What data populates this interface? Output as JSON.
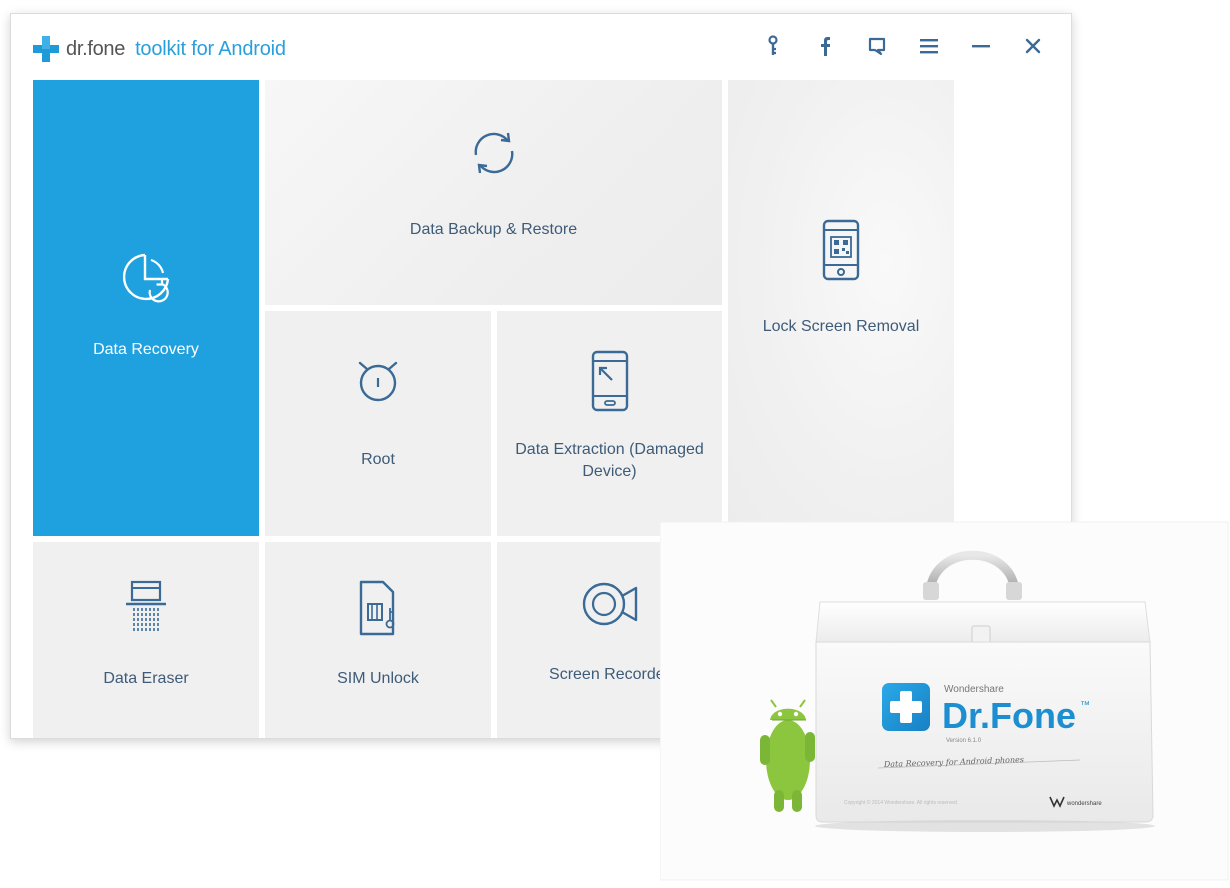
{
  "app": {
    "brand": "dr.fone",
    "product": "toolkit for Android"
  },
  "titlebar": {
    "icons": [
      "key-icon",
      "facebook-icon",
      "feedback-icon",
      "menu-icon",
      "minimize-icon",
      "close-icon"
    ]
  },
  "tiles": {
    "data_recovery": {
      "label": "Data Recovery",
      "icon": "pie-chart-refresh-icon"
    },
    "backup_restore": {
      "label": "Data Backup & Restore",
      "icon": "sync-icon"
    },
    "lock_screen": {
      "label": "Lock Screen Removal",
      "icon": "phone-lock-icon"
    },
    "root": {
      "label": "Root",
      "icon": "alarm-clock-icon"
    },
    "data_extraction": {
      "label": "Data Extraction (Damaged Device)",
      "icon": "phone-broken-icon"
    },
    "data_eraser": {
      "label": "Data Eraser",
      "icon": "shredder-icon"
    },
    "sim_unlock": {
      "label": "SIM Unlock",
      "icon": "sim-card-icon"
    },
    "screen_recorder": {
      "label": "Screen Recorder",
      "icon": "video-camera-icon"
    }
  },
  "box": {
    "maker": "Wondershare",
    "name": "Dr.Fone",
    "trademark": "™",
    "version": "Version 6.1.0",
    "tagline": "Data Recovery for Android phones",
    "copyright": "Copyright © 2014 Wondershare. All rights reserved.",
    "footer_brand": "wondershare"
  },
  "colors": {
    "accent": "#1fa1e0",
    "tile_bg": "#f0f0f0",
    "tile_text": "#3e5b78",
    "icon_stroke": "#3a6a95",
    "android_green": "#8cc63f"
  }
}
